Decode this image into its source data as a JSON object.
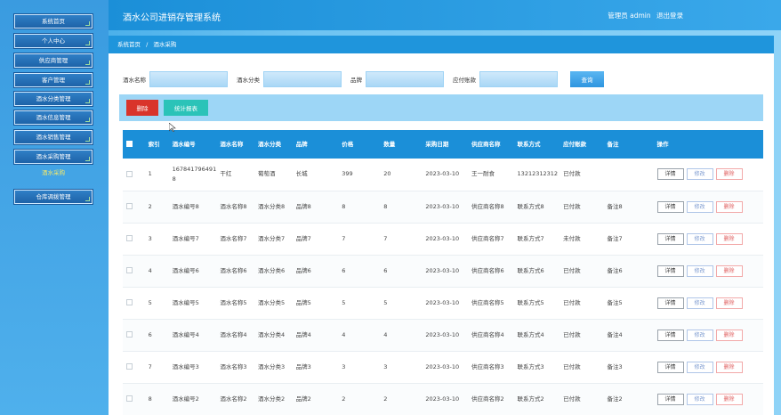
{
  "app": {
    "title": "酒水公司进销存管理系统"
  },
  "header": {
    "user_label": "管理员 admin",
    "logout_label": "退出登录"
  },
  "sidebar": {
    "items": [
      {
        "label": "系统首页"
      },
      {
        "label": "个人中心"
      },
      {
        "label": "供应商管理"
      },
      {
        "label": "客户管理"
      },
      {
        "label": "酒水分类管理"
      },
      {
        "label": "酒水信息管理"
      },
      {
        "label": "酒水销售管理"
      },
      {
        "label": "酒水采购管理"
      },
      {
        "label": "酒水采购"
      },
      {
        "label": "仓库调拨管理"
      }
    ]
  },
  "breadcrumb": {
    "home": "系统首页",
    "sep": "/",
    "current": "酒水采购"
  },
  "search": {
    "name_label": "酒水名称",
    "category_label": "酒水分类",
    "brand_label": "品牌",
    "payment_label": "应付账款",
    "button": "查询"
  },
  "actions": {
    "delete": "删除",
    "stats": "统计报表"
  },
  "table": {
    "headers": [
      "索引",
      "酒水编号",
      "酒水名称",
      "酒水分类",
      "品牌",
      "价格",
      "数量",
      "采购日期",
      "供应商名称",
      "联系方式",
      "应付账款",
      "备注",
      "操作"
    ],
    "op_labels": {
      "detail": "详情",
      "edit": "修改",
      "delete": "删除"
    },
    "rows": [
      {
        "idx": "1",
        "code": "1678417964918",
        "name": "干红",
        "cat": "葡萄酒",
        "brand": "长城",
        "price": "399",
        "qty": "20",
        "date": "2023-03-10",
        "supplier": "王一耐食",
        "contact": "13212312312",
        "pay": "已付款",
        "note": ""
      },
      {
        "idx": "2",
        "code": "酒水编号8",
        "name": "酒水名称8",
        "cat": "酒水分类8",
        "brand": "品牌8",
        "price": "8",
        "qty": "8",
        "date": "2023-03-10",
        "supplier": "供应商名称8",
        "contact": "联系方式8",
        "pay": "已付款",
        "note": "备注8"
      },
      {
        "idx": "3",
        "code": "酒水编号7",
        "name": "酒水名称7",
        "cat": "酒水分类7",
        "brand": "品牌7",
        "price": "7",
        "qty": "7",
        "date": "2023-03-10",
        "supplier": "供应商名称7",
        "contact": "联系方式7",
        "pay": "未付款",
        "note": "备注7"
      },
      {
        "idx": "4",
        "code": "酒水编号6",
        "name": "酒水名称6",
        "cat": "酒水分类6",
        "brand": "品牌6",
        "price": "6",
        "qty": "6",
        "date": "2023-03-10",
        "supplier": "供应商名称6",
        "contact": "联系方式6",
        "pay": "已付款",
        "note": "备注6"
      },
      {
        "idx": "5",
        "code": "酒水编号5",
        "name": "酒水名称5",
        "cat": "酒水分类5",
        "brand": "品牌5",
        "price": "5",
        "qty": "5",
        "date": "2023-03-10",
        "supplier": "供应商名称5",
        "contact": "联系方式5",
        "pay": "已付款",
        "note": "备注5"
      },
      {
        "idx": "6",
        "code": "酒水编号4",
        "name": "酒水名称4",
        "cat": "酒水分类4",
        "brand": "品牌4",
        "price": "4",
        "qty": "4",
        "date": "2023-03-10",
        "supplier": "供应商名称4",
        "contact": "联系方式4",
        "pay": "已付款",
        "note": "备注4"
      },
      {
        "idx": "7",
        "code": "酒水编号3",
        "name": "酒水名称3",
        "cat": "酒水分类3",
        "brand": "品牌3",
        "price": "3",
        "qty": "3",
        "date": "2023-03-10",
        "supplier": "供应商名称3",
        "contact": "联系方式3",
        "pay": "已付款",
        "note": "备注3"
      },
      {
        "idx": "8",
        "code": "酒水编号2",
        "name": "酒水名称2",
        "cat": "酒水分类2",
        "brand": "品牌2",
        "price": "2",
        "qty": "2",
        "date": "2023-03-10",
        "supplier": "供应商名称2",
        "contact": "联系方式2",
        "pay": "已付款",
        "note": "备注2"
      }
    ]
  },
  "colors": {
    "header": "#1b8fd8",
    "delete": "#d9342b",
    "stats": "#2bc3b8",
    "accent": "#39a6e6"
  }
}
